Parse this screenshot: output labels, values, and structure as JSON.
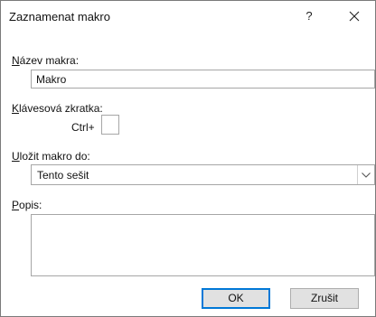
{
  "window": {
    "title": "Zaznamenat makro",
    "help_label": "?"
  },
  "macro_name": {
    "label_accel": "N",
    "label_rest": "ázev makra:",
    "value": "Makro"
  },
  "shortcut": {
    "label_accel": "K",
    "label_rest": "lávesová zkratka:",
    "prefix": "Ctrl+",
    "value": ""
  },
  "store_in": {
    "label_accel": "U",
    "label_rest": "ložit makro do:",
    "selected": "Tento sešit"
  },
  "description": {
    "label_accel": "P",
    "label_rest": "opis:",
    "value": ""
  },
  "buttons": {
    "ok": "OK",
    "cancel": "Zrušit"
  },
  "colors": {
    "default_button_border": "#0078d7",
    "button_face": "#e1e1e1",
    "field_border": "#a6a6a6"
  },
  "icons": {
    "close": "close-icon",
    "dropdown": "chevron-down-icon"
  }
}
